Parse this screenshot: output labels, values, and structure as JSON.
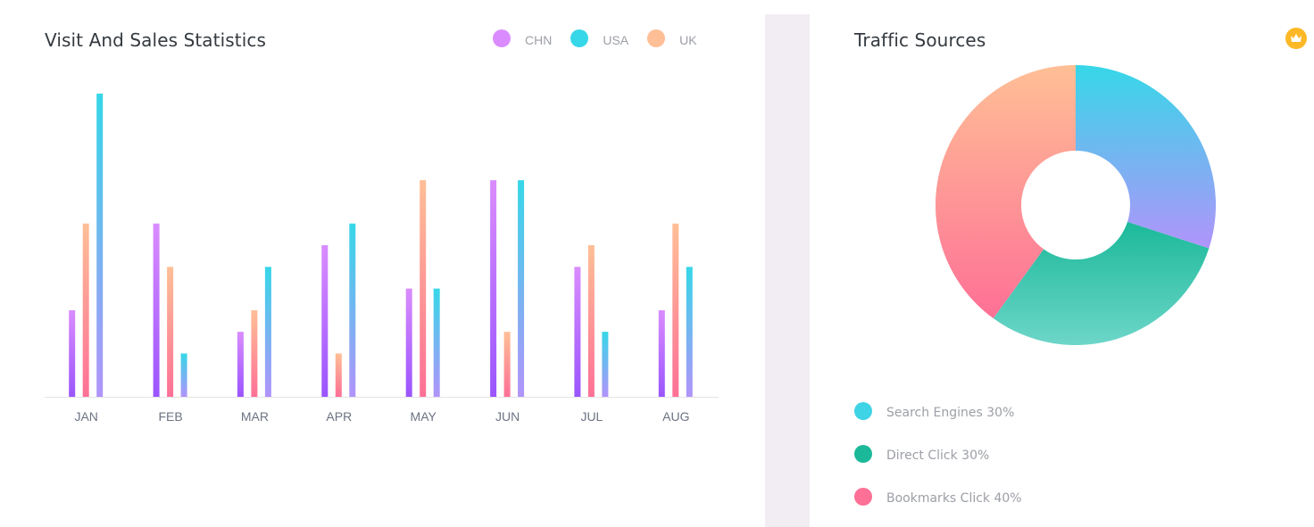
{
  "visit_card": {
    "title": "Visit And Sales Statistics"
  },
  "traffic_card": {
    "title": "Traffic Sources",
    "badge_icon": "crown-icon",
    "legend": [
      {
        "label": "Search Engines 30%",
        "color": "#3fd3e6"
      },
      {
        "label": "Direct Click 30%",
        "color": "#1bb99a"
      },
      {
        "label": "Bookmarks Click 40%",
        "color": "#fe7096"
      }
    ]
  },
  "chart_data": [
    {
      "type": "bar",
      "categories": [
        "JAN",
        "FEB",
        "MAR",
        "APR",
        "MAY",
        "JUN",
        "JUL",
        "AUG"
      ],
      "series": [
        {
          "name": "CHN",
          "values": [
            20,
            40,
            15,
            35,
            25,
            50,
            30,
            20
          ],
          "color_top": "#da8cff",
          "color_bottom": "#9a55ff"
        },
        {
          "name": "UK",
          "values": [
            40,
            30,
            20,
            10,
            50,
            15,
            35,
            40
          ],
          "color_top": "#ffbf96",
          "color_bottom": "#fe7096"
        },
        {
          "name": "USA",
          "values": [
            70,
            10,
            30,
            40,
            25,
            50,
            15,
            30
          ],
          "color_top": "#36d7e8",
          "color_bottom": "#b194fa"
        }
      ],
      "legend_order": [
        "CHN",
        "USA",
        "UK"
      ],
      "legend_colors": {
        "CHN": "#da8cff",
        "USA": "#36d7e8",
        "UK": "#ffbf96"
      },
      "ylim": [
        0,
        70
      ],
      "grid": false,
      "legend_position": "top-right"
    },
    {
      "type": "pie",
      "donut": true,
      "labels": [
        "Search Engines",
        "Direct Click",
        "Bookmarks Click"
      ],
      "values": [
        30,
        30,
        40
      ],
      "colors": [
        [
          "#36d7e8",
          "#b194fa"
        ],
        [
          "#1bb99a",
          "#6dd6c9"
        ],
        [
          "#ffbf96",
          "#fe7096"
        ]
      ]
    }
  ]
}
